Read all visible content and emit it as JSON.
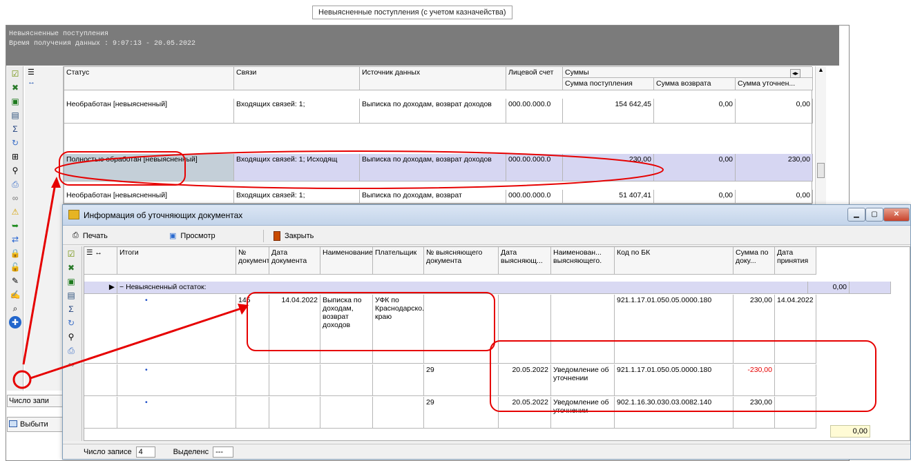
{
  "tab_title": "Невыясненные поступления (с учетом казначейства)",
  "header": {
    "title": "Невыясненные поступления",
    "time_line": "Время получения данных : 9:07:13 - 20.05.2022"
  },
  "main_grid": {
    "columns": [
      "Статус",
      "Связи",
      "Источник данных",
      "Лицевой счет",
      "Суммы"
    ],
    "sum_subcolumns": [
      "Сумма поступления",
      "Сумма возврата",
      "Сумма уточнен..."
    ],
    "rows": [
      {
        "status": "Необработан [невыясненный]",
        "links": "Входящих связей: 1;",
        "source": "Выписка по доходам, возврат доходов",
        "account": "000.00.000.0",
        "s1": "154 642,45",
        "s2": "0,00",
        "s3": "0,00"
      },
      {
        "status": "Полностью обработан [невыясненный]",
        "links": "Входящих связей: 1; Исходящ",
        "source": "Выписка по доходам, возврат доходов",
        "account": "000.00.000.0",
        "s1": "230,00",
        "s2": "0,00",
        "s3": "230,00"
      },
      {
        "status": "Необработан [невыясненный]",
        "links": "Входящих связей: 1;",
        "source": "Выписка по доходам, возврат",
        "account": "000.00.000.0",
        "s1": "51 407,41",
        "s2": "0,00",
        "s3": "0,00"
      }
    ]
  },
  "bg_status": {
    "records_label": "Число запи",
    "bottom_btn": "Выбыти"
  },
  "dialog": {
    "title": "Информация об уточняющих документах",
    "toolbar": {
      "print": "Печать",
      "preview": "Просмотр",
      "close": "Закрыть"
    },
    "columns": [
      "Итоги",
      "№ документа",
      "Дата документа",
      "Наименование",
      "Плательщик",
      "№ выясняющего документа",
      "Дата выясняющ...",
      "Наименован... выясняющего.",
      "Код по БК",
      "Сумма по доку...",
      "Дата принятия"
    ],
    "group_row": {
      "label": "Невыясненный остаток:",
      "sum": "0,00"
    },
    "rows": [
      {
        "num": "145",
        "date": "14.04.2022",
        "name": "Выписка по доходам, возврат доходов",
        "payer": "УФК по Краснодарско.. краю",
        "cnum": "",
        "cdate": "",
        "cname": "",
        "kbk": "921.1.17.01.050.05.0000.180",
        "sum": "230,00",
        "accept": "14.04.2022",
        "neg": false
      },
      {
        "num": "",
        "date": "",
        "name": "",
        "payer": "",
        "cnum": "29",
        "cdate": "20.05.2022",
        "cname": "Уведомление об уточнении",
        "kbk": "921.1.17.01.050.05.0000.180",
        "sum": "-230,00",
        "accept": "",
        "neg": true
      },
      {
        "num": "",
        "date": "",
        "name": "",
        "payer": "",
        "cnum": "29",
        "cdate": "20.05.2022",
        "cname": "Уведомление об уточнении",
        "kbk": "902.1.16.30.030.03.0082.140",
        "sum": "230,00",
        "accept": "",
        "neg": false
      }
    ],
    "total": "0,00",
    "status": {
      "records_label": "Число записе",
      "records_value": "4",
      "selected_label": "Выделенс",
      "selected_value": "---"
    }
  },
  "colors": {
    "highlight": "#e60000",
    "selected_row": "#d6d6f2",
    "header_bg": "#7b7b7b",
    "group_row": "#d9d9f3"
  }
}
